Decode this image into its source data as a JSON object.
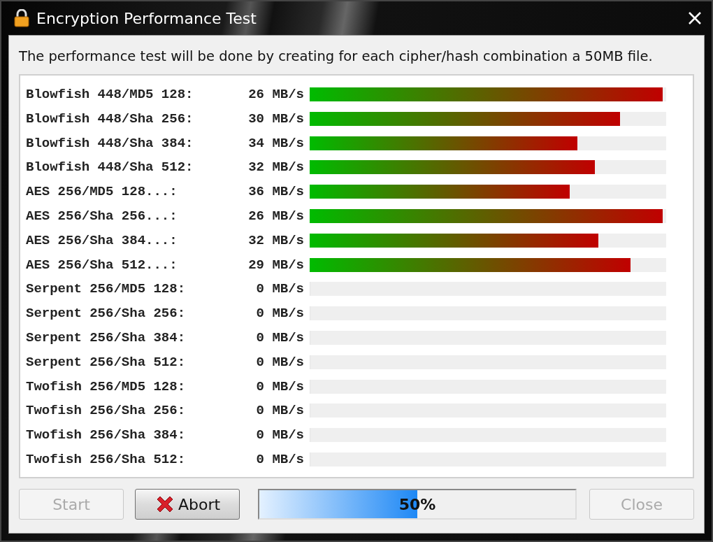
{
  "window": {
    "title": "Encryption Performance Test"
  },
  "description": "The performance test will be done by creating for each cipher/hash combination a 50MB file.",
  "results": [
    {
      "name": "Blowfish 448/MD5 128:",
      "speed": "26 MB/s",
      "level": 0.99
    },
    {
      "name": "Blowfish 448/Sha 256:",
      "speed": "30 MB/s",
      "level": 0.87
    },
    {
      "name": "Blowfish 448/Sha 384:",
      "speed": "34 MB/s",
      "level": 0.75
    },
    {
      "name": "Blowfish 448/Sha 512:",
      "speed": "32 MB/s",
      "level": 0.8
    },
    {
      "name": "AES 256/MD5 128...:",
      "speed": "36 MB/s",
      "level": 0.73
    },
    {
      "name": "AES 256/Sha 256...:",
      "speed": "26 MB/s",
      "level": 0.99
    },
    {
      "name": "AES 256/Sha 384...:",
      "speed": "32 MB/s",
      "level": 0.81
    },
    {
      "name": "AES 256/Sha 512...:",
      "speed": "29 MB/s",
      "level": 0.9
    },
    {
      "name": "Serpent 256/MD5 128:",
      "speed": "0 MB/s",
      "level": 0
    },
    {
      "name": "Serpent 256/Sha 256:",
      "speed": "0 MB/s",
      "level": 0
    },
    {
      "name": "Serpent 256/Sha 384:",
      "speed": "0 MB/s",
      "level": 0
    },
    {
      "name": "Serpent 256/Sha 512:",
      "speed": "0 MB/s",
      "level": 0
    },
    {
      "name": "Twofish 256/MD5 128:",
      "speed": "0 MB/s",
      "level": 0
    },
    {
      "name": "Twofish 256/Sha 256:",
      "speed": "0 MB/s",
      "level": 0
    },
    {
      "name": "Twofish 256/Sha 384:",
      "speed": "0 MB/s",
      "level": 0
    },
    {
      "name": "Twofish 256/Sha 512:",
      "speed": "0 MB/s",
      "level": 0
    }
  ],
  "buttons": [
    {
      "label": "Start",
      "kind": "plain",
      "disabled": true
    },
    {
      "label": "Abort",
      "kind": "abort",
      "disabled": false
    }
  ],
  "progress": {
    "level": 0.5,
    "reading": "50%"
  },
  "close_button": {
    "label": "Close",
    "disabled": true
  }
}
